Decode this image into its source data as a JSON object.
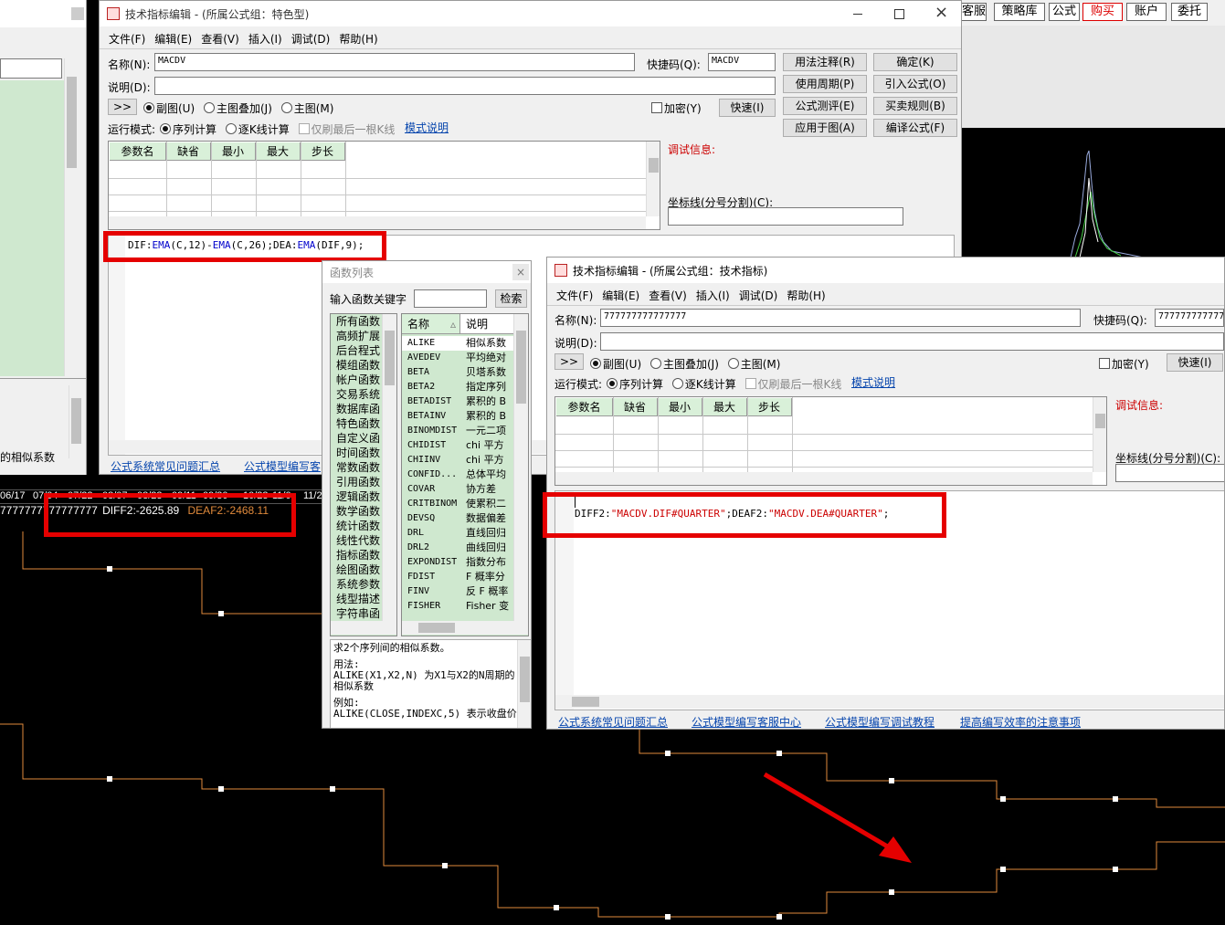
{
  "left_panel": {
    "bottom_label": "的相似系数"
  },
  "chart_strip": {
    "dates": [
      "06/17",
      "07/04",
      "07/22",
      "08/07",
      "08/23",
      "09/11",
      "09/30",
      "10/23",
      "11/0",
      "11/2"
    ],
    "series_label": "7777777777777777",
    "diff2_value": "DIFF2:-2625.89",
    "deaf2_value": "DEAF2:-2468.11"
  },
  "top_toolbar": {
    "items": [
      "客服",
      "策略库",
      "公式",
      "购买",
      "账户",
      "委托"
    ]
  },
  "editor1": {
    "title": "技术指标编辑 - (所属公式组：特色型)",
    "menu": [
      "文件(F)",
      "编辑(E)",
      "查看(V)",
      "插入(I)",
      "调试(D)",
      "帮助(H)"
    ],
    "name_label": "名称(N):",
    "name_value": "MACDV",
    "shortcut_label": "快捷码(Q):",
    "shortcut_value": "MACDV",
    "desc_label": "说明(D):",
    "desc_value": "",
    "expand_btn": ">>",
    "radios": [
      "副图(U)",
      "主图叠加(J)",
      "主图(M)"
    ],
    "encrypt_label": "加密(Y)",
    "quick_btn": "快速(I)",
    "run_mode_label": "运行模式:",
    "run_modes": [
      "序列计算",
      "逐K线计算"
    ],
    "refresh_last": "仅刷最后一根K线",
    "mode_help": "模式说明",
    "param_headers": [
      "参数名",
      "缺省",
      "最小",
      "最大",
      "步长"
    ],
    "buttons": [
      "用法注释(R)",
      "确定(K)",
      "使用周期(P)",
      "引入公式(O)",
      "公式测评(E)",
      "买卖规则(B)",
      "应用于图(A)",
      "编译公式(F)"
    ],
    "debug_label": "调试信息:",
    "axis_label": "坐标线(分号分割)(C):",
    "code": [
      {
        "t": "DIF:",
        "c": "#000"
      },
      {
        "t": "EMA",
        "c": "#0000cc"
      },
      {
        "t": "(C,12)-",
        "c": "#000"
      },
      {
        "t": "EMA",
        "c": "#0000cc"
      },
      {
        "t": "(C,26);DEA:",
        "c": "#000"
      },
      {
        "t": "EMA",
        "c": "#0000cc"
      },
      {
        "t": "(DIF,9);",
        "c": "#000"
      }
    ],
    "footer_links": [
      "公式系统常见问题汇总",
      "公式模型编写客"
    ]
  },
  "func_list": {
    "title": "函数列表",
    "keyword_label": "输入函数关键字",
    "search_btn": "检索",
    "categories": [
      "所有函数",
      "高频扩展",
      "后台程式",
      "模组函数",
      "帐户函数",
      "交易系统",
      "数据库函",
      "特色函数",
      "自定义函",
      "时间函数",
      "常数函数",
      "引用函数",
      "逻辑函数",
      "数学函数",
      "统计函数",
      "线性代数",
      "指标函数",
      "绘图函数",
      "系统参数",
      "线型描述",
      "字符串函"
    ],
    "col_name": "名称",
    "col_desc": "说明",
    "functions": [
      {
        "n": "ALIKE",
        "d": "相似系数"
      },
      {
        "n": "AVEDEV",
        "d": "平均绝对"
      },
      {
        "n": "BETA",
        "d": "贝塔系数"
      },
      {
        "n": "BETA2",
        "d": "指定序列"
      },
      {
        "n": "BETADIST",
        "d": "累积的 B"
      },
      {
        "n": "BETAINV",
        "d": "累积的 B"
      },
      {
        "n": "BINOMDIST",
        "d": "一元二项"
      },
      {
        "n": "CHIDIST",
        "d": "chi 平方"
      },
      {
        "n": "CHIINV",
        "d": "chi 平方"
      },
      {
        "n": "CONFID...",
        "d": "总体平均"
      },
      {
        "n": "COVAR",
        "d": "协方差"
      },
      {
        "n": "CRITBINOM",
        "d": "使累积二"
      },
      {
        "n": "DEVSQ",
        "d": "数据偏差"
      },
      {
        "n": "DRL",
        "d": "直线回归"
      },
      {
        "n": "DRL2",
        "d": "曲线回归"
      },
      {
        "n": "EXPONDIST",
        "d": "指数分布"
      },
      {
        "n": "FDIST",
        "d": "F 概率分"
      },
      {
        "n": "FINV",
        "d": "反 F 概率"
      },
      {
        "n": "FISHER",
        "d": "Fisher 变"
      }
    ],
    "help_lines": [
      "求2个序列间的相似系数。",
      "",
      "用法:",
      "ALIKE(X1,X2,N) 为X1与X2的N周期的",
      "相似系数",
      "",
      "例如:",
      "ALIKE(CLOSE,INDEXC,5) 表示收盘价"
    ]
  },
  "editor2": {
    "title": "技术指标编辑 - (所属公式组：技术指标)",
    "menu": [
      "文件(F)",
      "编辑(E)",
      "查看(V)",
      "插入(I)",
      "调试(D)",
      "帮助(H)"
    ],
    "name_label": "名称(N):",
    "name_value": "777777777777777",
    "shortcut_label": "快捷码(Q):",
    "shortcut_value": "777777777777",
    "desc_label": "说明(D):",
    "desc_value": "",
    "expand_btn": ">>",
    "radios": [
      "副图(U)",
      "主图叠加(J)",
      "主图(M)"
    ],
    "encrypt_label": "加密(Y)",
    "quick_btn": "快速(I)",
    "run_mode_label": "运行模式:",
    "run_modes": [
      "序列计算",
      "逐K线计算"
    ],
    "refresh_last": "仅刷最后一根K线",
    "mode_help": "模式说明",
    "param_headers": [
      "参数名",
      "缺省",
      "最小",
      "最大",
      "步长"
    ],
    "debug_label": "调试信息:",
    "axis_label": "坐标线(分号分割)(C):",
    "code": [
      {
        "t": "DIFF2:",
        "c": "#000"
      },
      {
        "t": "\"MACDV.DIF#QUARTER\"",
        "c": "#cc0000"
      },
      {
        "t": ";DEAF2:",
        "c": "#000"
      },
      {
        "t": "\"MACDV.DEA#QUARTER\"",
        "c": "#cc0000"
      },
      {
        "t": ";",
        "c": "#000"
      }
    ],
    "footer_links": [
      "公式系统常见问题汇总",
      "公式模型编写客服中心",
      "公式模型编写调试教程",
      "提高编写效率的注意事项"
    ]
  },
  "colors": {
    "chart_line": "#e08a3c",
    "annotation_red": "#e50000",
    "grid_header_green": "#d9f0d9",
    "link_blue": "#0645ad"
  }
}
